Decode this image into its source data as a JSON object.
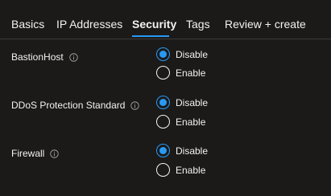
{
  "tabs": [
    {
      "label": "Basics",
      "active": false
    },
    {
      "label": "IP Addresses",
      "active": false
    },
    {
      "label": "Security",
      "active": true
    },
    {
      "label": "Tags",
      "active": false
    },
    {
      "label": "Review + create",
      "active": false
    }
  ],
  "settings": [
    {
      "label": "BastionHost",
      "info_icon": "info-icon",
      "options": [
        {
          "label": "Disable",
          "checked": true
        },
        {
          "label": "Enable",
          "checked": false
        }
      ]
    },
    {
      "label": "DDoS Protection Standard",
      "info_icon": "info-icon",
      "options": [
        {
          "label": "Disable",
          "checked": true
        },
        {
          "label": "Enable",
          "checked": false
        }
      ]
    },
    {
      "label": "Firewall",
      "info_icon": "info-icon",
      "options": [
        {
          "label": "Disable",
          "checked": true
        },
        {
          "label": "Enable",
          "checked": false
        }
      ]
    }
  ],
  "colors": {
    "background": "#1b1a19",
    "accent": "#2899f5",
    "text": "#f3f2f1"
  }
}
